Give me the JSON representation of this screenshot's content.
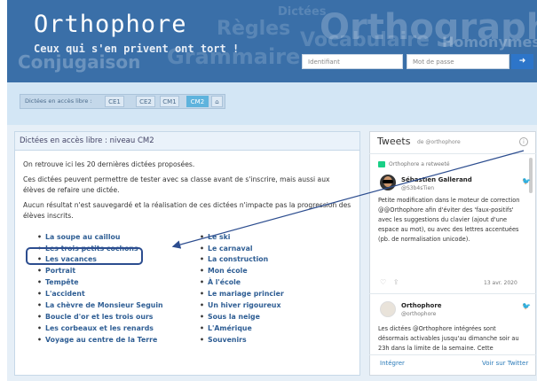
{
  "header": {
    "logo": "Orthophore",
    "tagline": "Ceux qui s'en privent ont tort !",
    "background_words": [
      "Orthographe",
      "Dictées",
      "Conjugaison",
      "Grammaire",
      "Homonymes",
      "Règles",
      "Vocabulaire"
    ],
    "login": {
      "id_placeholder": "Identifiant",
      "password_placeholder": "Mot de passe",
      "submit_icon": "arrow-right-icon"
    }
  },
  "breadcrumb": {
    "label": "Dictées en accès libre :",
    "levels": [
      "CE1",
      "CE2",
      "CM1",
      "CM2"
    ],
    "active": "CM2",
    "home_icon": "home-icon"
  },
  "main": {
    "title": "Dictées en accès libre : niveau CM2",
    "paragraphs": [
      "On retrouve ici les 20 dernières dictées proposées.",
      "Ces dictées peuvent permettre de tester avec sa classe avant de s'inscrire, mais aussi aux élèves de refaire une dictée.",
      "Aucun résultat n'est sauvegardé et la réalisation de ces dictées n'impacte pas la progression des élèves inscrits."
    ],
    "col1": [
      "La soupe au caillou",
      "Les trois petits cochons",
      "Les vacances",
      "Portrait",
      "Tempête",
      "L'accident",
      "La chèvre de Monsieur Seguin",
      "Boucle d'or et les trois ours",
      "Les corbeaux et les renards",
      "Voyage au centre de la Terre"
    ],
    "col2": [
      "Le ski",
      "Le carnaval",
      "La construction",
      "Mon école",
      "À l'école",
      "Le mariage princier",
      "Un hiver rigoureux",
      "Sous la neige",
      "L'Amérique",
      "Souvenirs"
    ]
  },
  "twitter": {
    "title": "Tweets",
    "by": "de @orthophore",
    "retweet_label": "Orthophore a retweeté",
    "tweet1": {
      "name": "Sébastien Gallerand",
      "handle": "@S3b4sTien",
      "text": "Petite modification dans le moteur de correction @@Orthophore afin d'éviter des 'faux-positifs' avec les suggestions du clavier (ajout d'une espace au mot), ou avec des lettres accentuées (pb. de normalisation unicode).",
      "date": "13 avr. 2020"
    },
    "tweet2": {
      "name": "Orthophore",
      "handle": "@orthophore",
      "text": "Les dictées @Orthophore intégrées sont désormais activables jusqu'au dimanche soir au 23h dans la limite de la semaine. Cette"
    },
    "footer": {
      "embed": "Intégrer",
      "view": "Voir sur Twitter"
    }
  },
  "colors": {
    "header": "#3a6fa8",
    "strip": "#d3e6f5",
    "active_tab": "#5eb3dd",
    "link": "#2f5e94",
    "annotation": "#2c4d8f"
  }
}
